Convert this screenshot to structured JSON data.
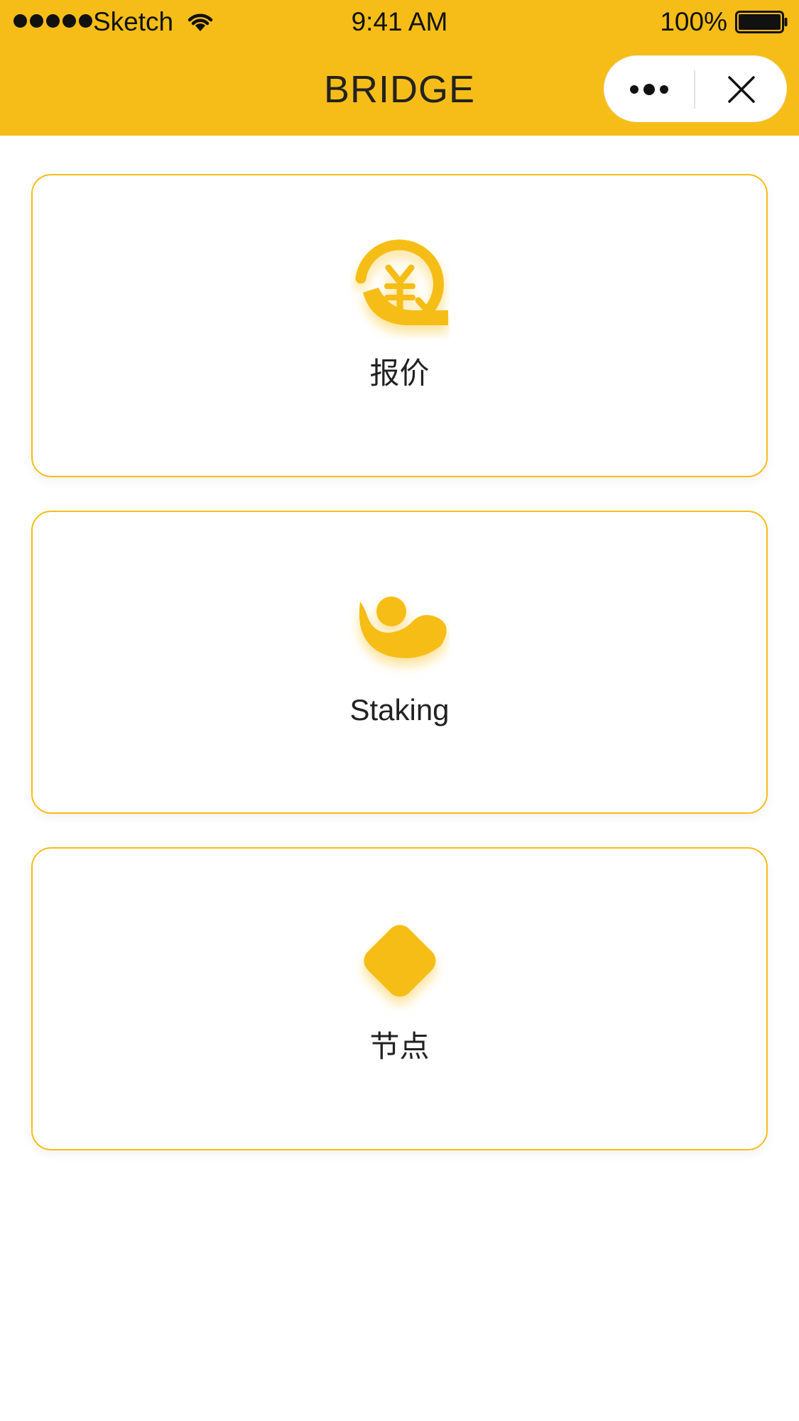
{
  "status_bar": {
    "carrier": "Sketch",
    "time": "9:41 AM",
    "battery": "100%"
  },
  "nav": {
    "title": "BRIDGE",
    "more_icon": "more-dots-icon",
    "close_icon": "close-icon"
  },
  "cards": [
    {
      "label": "报价",
      "icon": "yuan-exchange-icon"
    },
    {
      "label": "Staking",
      "icon": "ingot-icon"
    },
    {
      "label": "节点",
      "icon": "diamond-icon"
    }
  ],
  "colors": {
    "accent": "#F6BD19",
    "text": "#222222",
    "background": "#FFFFFF"
  }
}
